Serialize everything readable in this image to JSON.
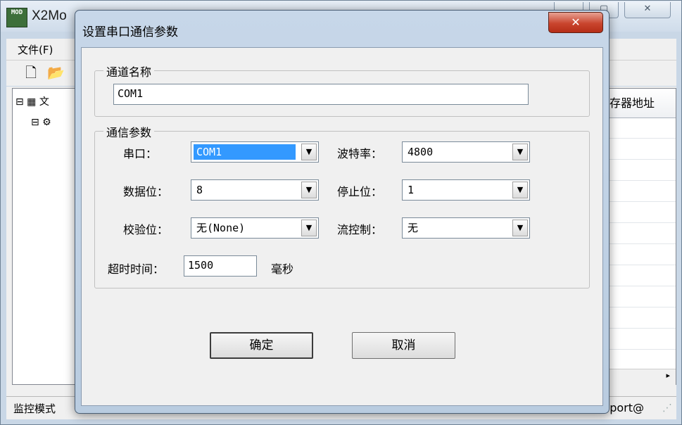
{
  "main_window": {
    "app_icon_text": "MOD",
    "title": "X2Mo",
    "menu": {
      "file": "文件(F)"
    },
    "tree": {
      "root_label": "文"
    },
    "grid": {
      "column_header": "存器地址"
    },
    "status": {
      "left": "监控模式",
      "right": "port@"
    }
  },
  "dialog": {
    "title": "设置串口通信参数",
    "close_glyph": "✕",
    "channel_group": {
      "label": "通道名称",
      "name_value": "COM1"
    },
    "params_group": {
      "label": "通信参数",
      "fields": {
        "port": {
          "label": "串口：",
          "value": "COM1"
        },
        "baud": {
          "label": "波特率：",
          "value": "4800"
        },
        "data_bits": {
          "label": "数据位：",
          "value": "8"
        },
        "stop_bits": {
          "label": "停止位：",
          "value": "1"
        },
        "parity": {
          "label": "校验位：",
          "value": "无(None)"
        },
        "flow": {
          "label": "流控制：",
          "value": "无"
        }
      },
      "timeout": {
        "label": "超时时间：",
        "value": "1500",
        "unit": "毫秒"
      }
    },
    "buttons": {
      "ok": "确定",
      "cancel": "取消"
    }
  },
  "colors": {
    "selection": "#3399ff",
    "close_button": "#c9452e",
    "dialog_frame": "#b9cce0"
  }
}
